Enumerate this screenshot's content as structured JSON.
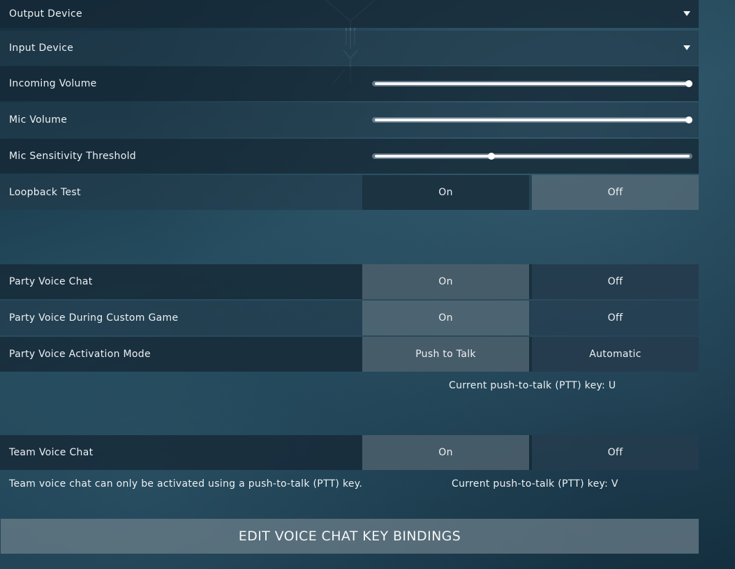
{
  "audio": {
    "output_device": {
      "label": "Output Device"
    },
    "input_device": {
      "label": "Input Device"
    },
    "incoming_volume": {
      "label": "Incoming Volume",
      "value": 1.0
    },
    "mic_volume": {
      "label": "Mic Volume",
      "value": 1.0
    },
    "mic_sensitivity": {
      "label": "Mic Sensitivity Threshold",
      "value": 0.37
    },
    "loopback": {
      "label": "Loopback Test",
      "on": "On",
      "off": "Off",
      "selected": "off"
    }
  },
  "party": {
    "voice_chat": {
      "label": "Party Voice Chat",
      "on": "On",
      "off": "Off",
      "selected": "on"
    },
    "custom_game": {
      "label": "Party Voice During Custom Game",
      "on": "On",
      "off": "Off",
      "selected": "on"
    },
    "activation_mode": {
      "label": "Party Voice Activation Mode",
      "ptt": "Push to Talk",
      "auto": "Automatic",
      "selected": "ptt"
    },
    "ptt_key_text": "Current push-to-talk (PTT) key: U"
  },
  "team": {
    "voice_chat": {
      "label": "Team Voice Chat",
      "on": "On",
      "off": "Off",
      "selected": "on"
    },
    "note": "Team voice chat can only be activated using a push-to-talk (PTT) key.",
    "ptt_key_text": "Current push-to-talk (PTT) key: V"
  },
  "edit_button": "EDIT VOICE CHAT KEY BINDINGS",
  "colors": {
    "selected_bg": "#6e828c",
    "text": "#eef1f3",
    "slider_fill": "#f5f7f8"
  }
}
